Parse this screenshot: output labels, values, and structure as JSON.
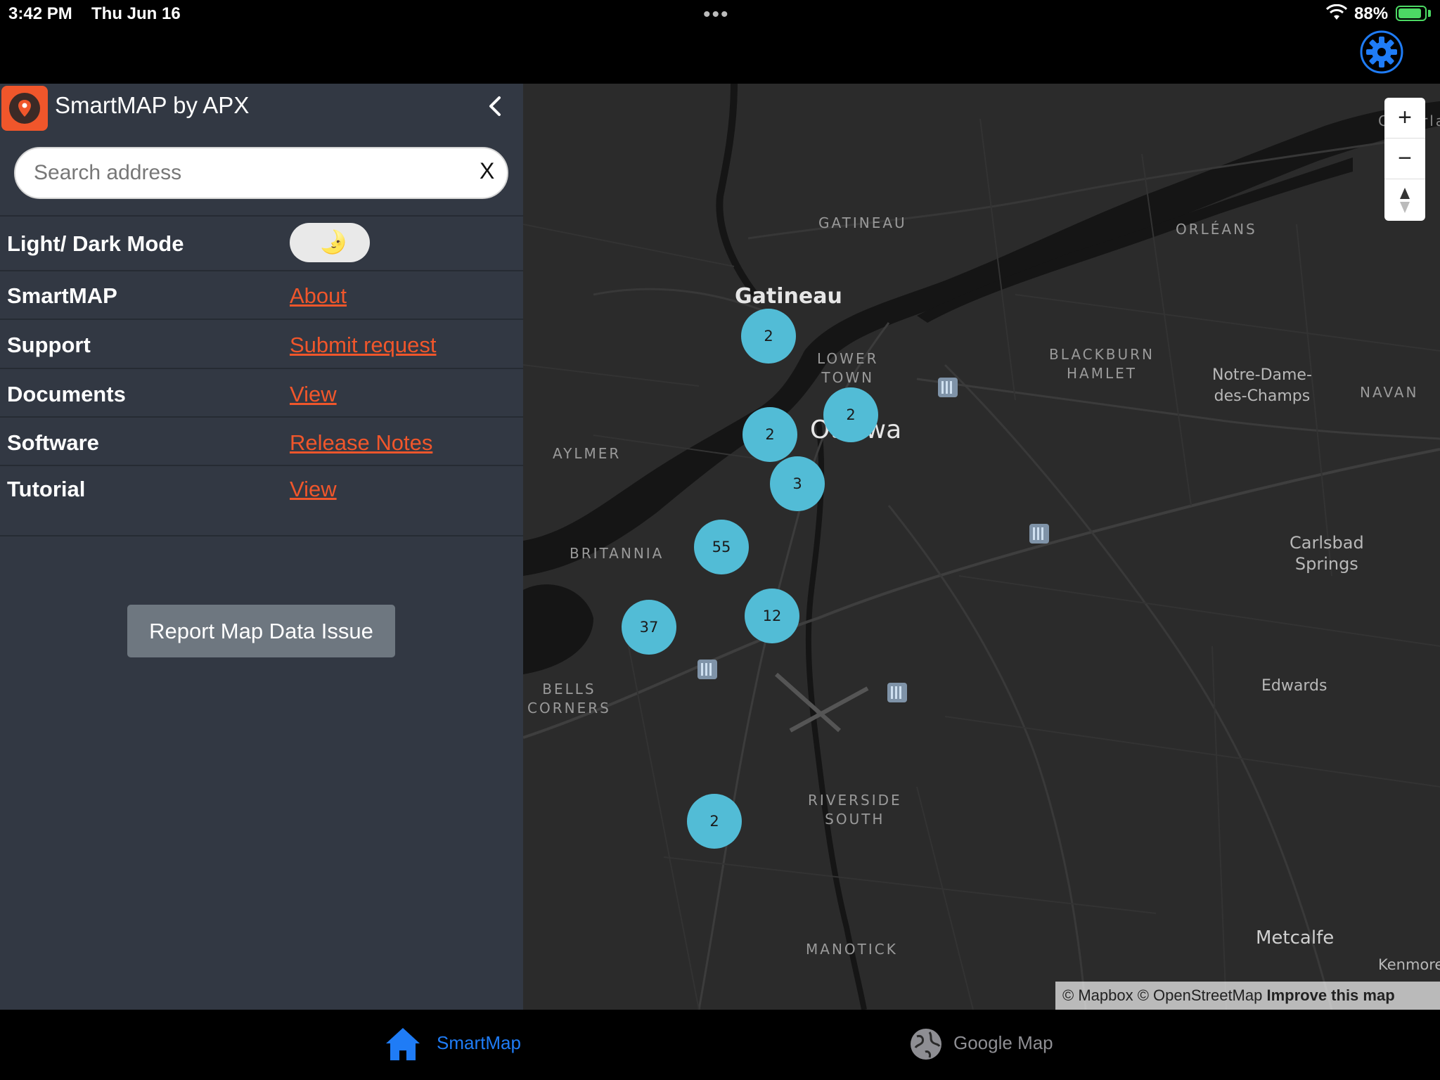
{
  "status_bar": {
    "time": "3:42 PM",
    "date": "Thu Jun 16",
    "battery": "88%",
    "battery_level": 0.88
  },
  "app": {
    "title": "SmartMAP by APX",
    "accent_color": "#f0562b"
  },
  "search": {
    "placeholder": "Search address",
    "clear_label": "X"
  },
  "settings": [
    {
      "label": "Light/ Dark Mode",
      "type": "toggle",
      "toggle_icon": "moon-icon",
      "toggle_glyph": "🌛"
    },
    {
      "label": "SmartMAP",
      "link": "About"
    },
    {
      "label": "Support",
      "link": "Submit request"
    },
    {
      "label": "Documents",
      "link": "View"
    },
    {
      "label": "Software",
      "link": "Release Notes"
    },
    {
      "label": "Tutorial",
      "link": "View"
    }
  ],
  "report_button": "Report Map Data Issue",
  "map": {
    "theme": "dark",
    "labels": {
      "gatineau_district": "GATINEAU",
      "orleans": "ORLÉANS",
      "gatineau": "Gatineau",
      "lower_town": "LOWER\nTOWN",
      "blackburn": "BLACKBURN\nHAMLET",
      "notre_dame": "Notre-Dame-\ndes-Champs",
      "navan": "NAVAN",
      "aylmer": "AYLMER",
      "ottawa": "Ottawa",
      "britannia": "BRITANNIA",
      "carlsbad": "Carlsbad\nSprings",
      "bells_corners": "BELLS\nCORNERS",
      "edwards": "Edwards",
      "riverside_south": "RIVERSIDE\nSOUTH",
      "manotick": "MANOTICK",
      "metcalfe": "Metcalfe",
      "kenmore": "Kenmore",
      "cumberland_partial": "C",
      "clarence_partial": "rla"
    },
    "clusters": [
      "2",
      "2",
      "2",
      "3",
      "55",
      "12",
      "37",
      "2"
    ],
    "cluster_color": "#52bcd6",
    "attribution": {
      "mapbox": "© Mapbox",
      "osm": "© OpenStreetMap",
      "improve": "Improve this map"
    },
    "zoom_in": "+",
    "zoom_out": "−"
  },
  "tabs": [
    {
      "label": "SmartMap",
      "icon": "home-icon",
      "active": true,
      "color": "#1f7cf6"
    },
    {
      "label": "Google Map",
      "icon": "globe-icon",
      "active": false,
      "color": "#8e8e93"
    }
  ]
}
